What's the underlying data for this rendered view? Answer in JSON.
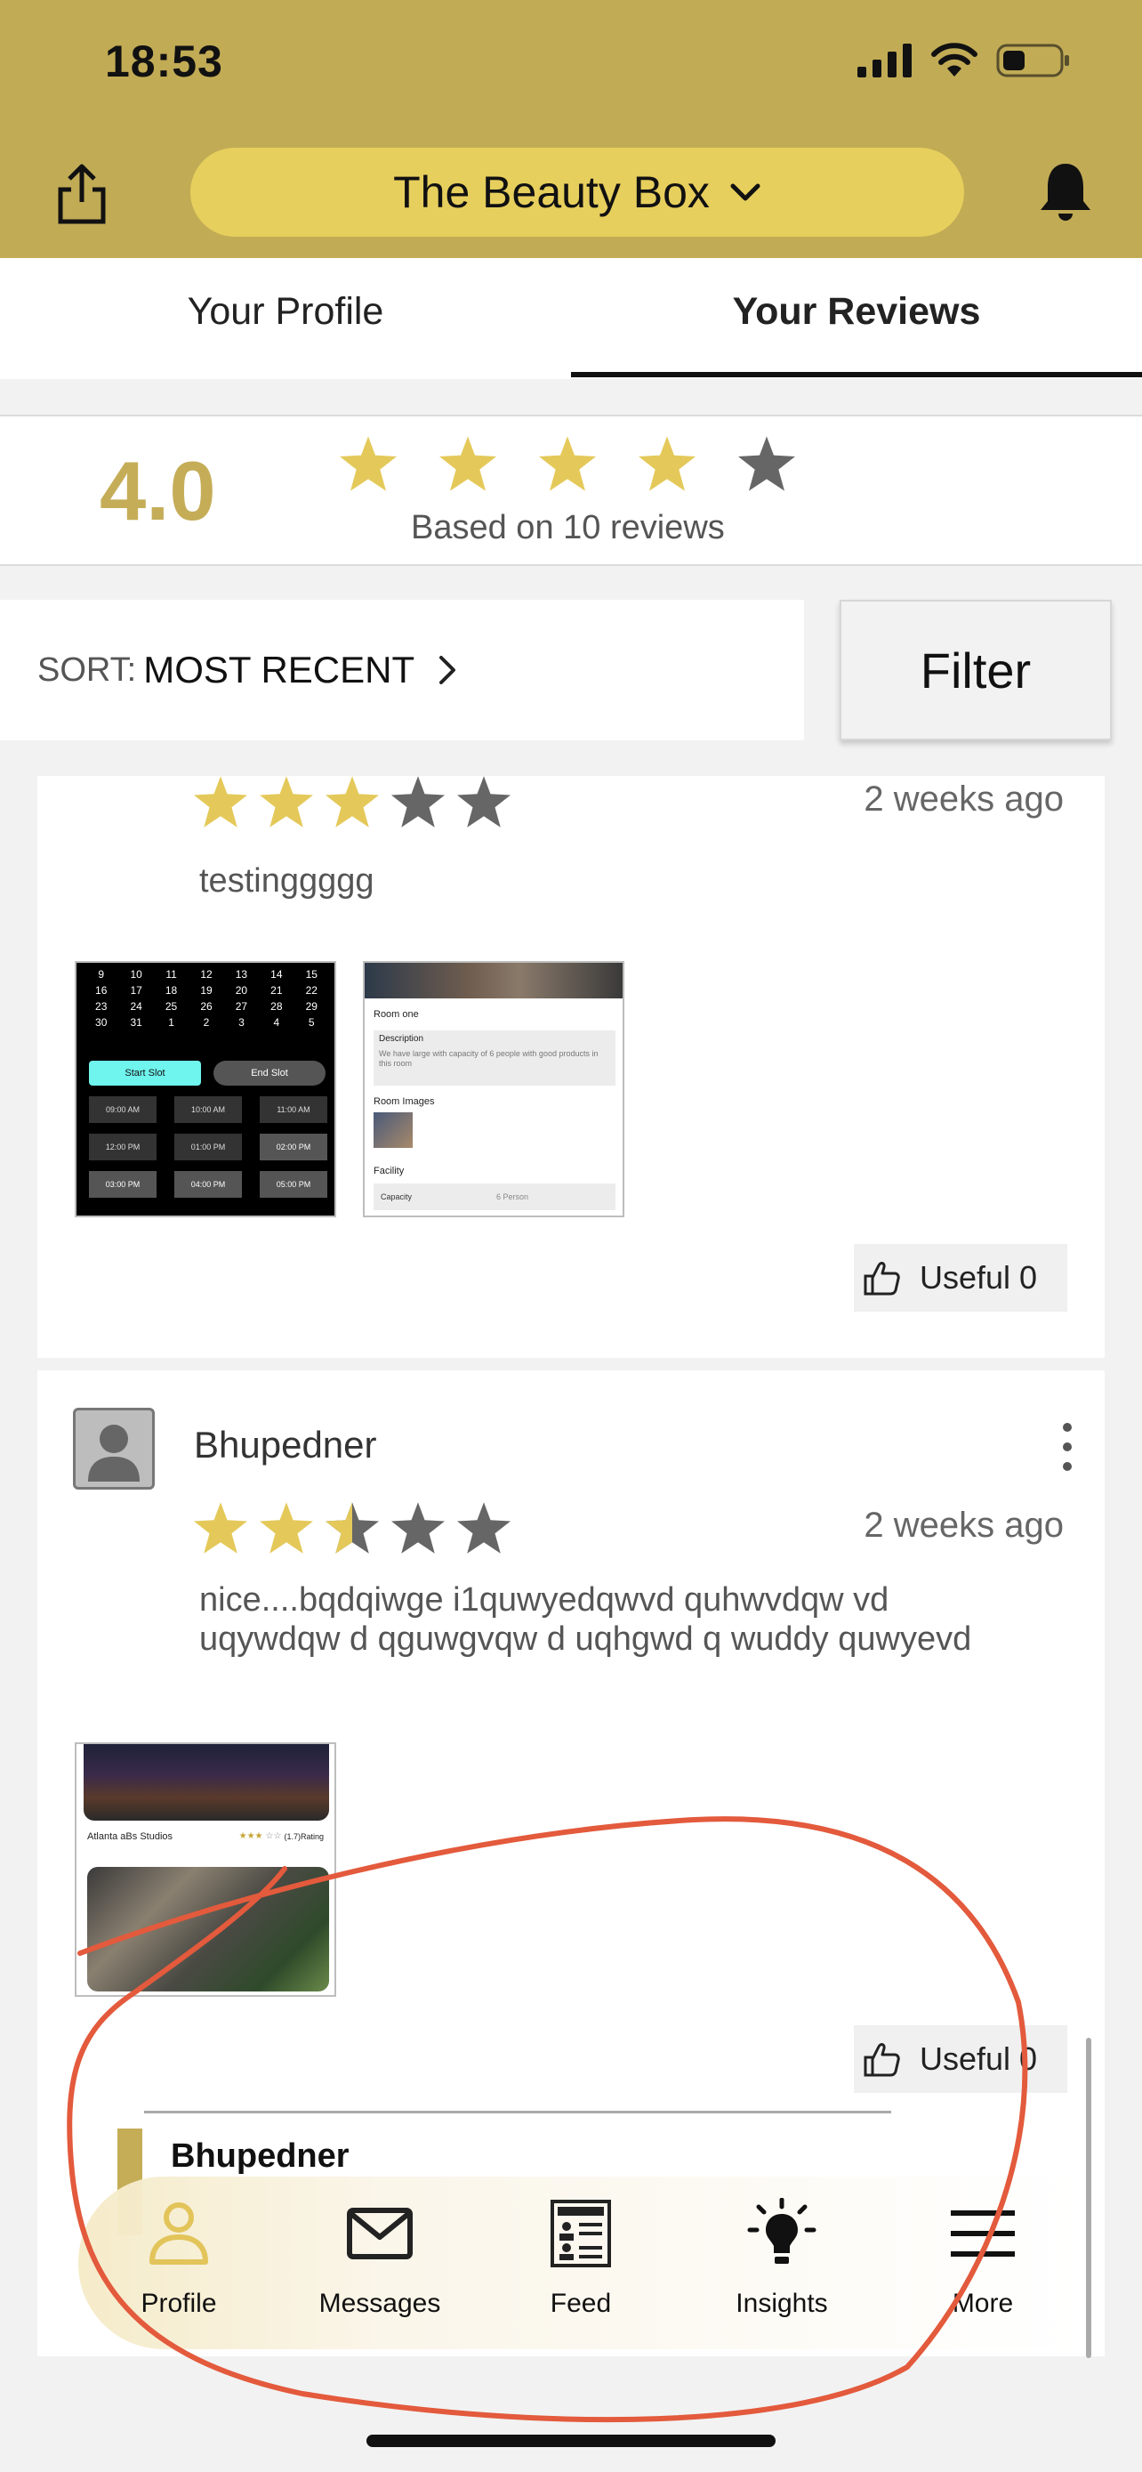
{
  "status_bar": {
    "time": "18:53"
  },
  "header": {
    "business_name": "The Beauty Box"
  },
  "tabs": [
    {
      "label": "Your Profile"
    },
    {
      "label": "Your Reviews",
      "active": true
    }
  ],
  "summary": {
    "rating": "4.0",
    "stars_filled": 4,
    "stars_total": 5,
    "caption": "Based on 10 reviews"
  },
  "sort": {
    "label": "SORT:",
    "value": "MOST RECENT"
  },
  "filter": {
    "label": "Filter"
  },
  "reviews": [
    {
      "stars": 3,
      "time": "2 weeks ago",
      "text": "testinggggg",
      "useful_label": "Useful 0",
      "images": {
        "calendar_dates": [
          "9",
          "10",
          "11",
          "12",
          "13",
          "14",
          "15",
          "16",
          "17",
          "18",
          "19",
          "20",
          "21",
          "22",
          "23",
          "24",
          "25",
          "26",
          "27",
          "28",
          "29",
          "30",
          "31",
          "1",
          "2",
          "3",
          "4",
          "5"
        ],
        "start_slot": "Start Slot",
        "end_slot": "End Slot",
        "time_slots": [
          "09:00 AM",
          "10:00 AM",
          "11:00 AM",
          "12:00 PM",
          "01:00 PM",
          "02:00 PM",
          "03:00 PM",
          "04:00 PM",
          "05:00 PM"
        ],
        "room_title": "Room one",
        "description_label": "Description",
        "description_text": "We have large with capacity of 6 people with good products in this room",
        "room_images_label": "Room Images",
        "facility_label": "Facility",
        "capacity_label": "Capacity",
        "capacity_value": "6 Person"
      }
    },
    {
      "reviewer": "Bhupedner",
      "stars": 2.5,
      "time": "2 weeks ago",
      "text": "nice....bqdqiwge i1quwyedqwvd quhwvdqw vd uqywdqw d qguwgvqw d uqhgwd q wuddy quwyevd",
      "useful_label": "Useful 0",
      "images": {
        "studio_name": "Atlanta aBs Studios",
        "studio_rating": "(1.7)Rating"
      },
      "reply": {
        "name": "Bhupedner"
      }
    }
  ],
  "bottom_nav": [
    {
      "label": "Profile",
      "icon": "person-icon",
      "active": true
    },
    {
      "label": "Messages",
      "icon": "envelope-icon"
    },
    {
      "label": "Feed",
      "icon": "newspaper-icon"
    },
    {
      "label": "Insights",
      "icon": "lightbulb-icon"
    },
    {
      "label": "More",
      "icon": "menu-icon"
    }
  ],
  "colors": {
    "header": "#c1ab55",
    "pill": "#e7cf5d",
    "star_filled": "#e4c95a",
    "star_empty": "#666666",
    "annotation": "#e35a3c"
  }
}
